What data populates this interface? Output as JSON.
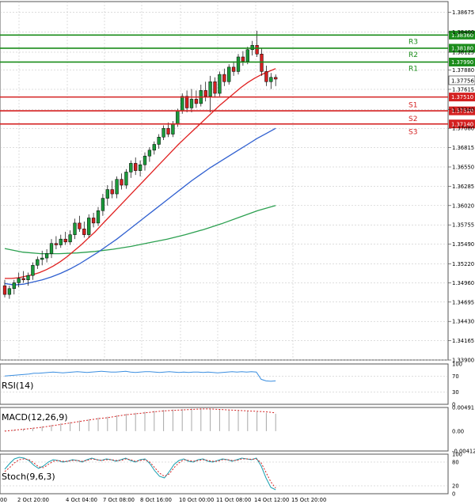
{
  "chart_data": [
    {
      "type": "candlestick",
      "price_ylim": [
        1.339,
        1.3882
      ],
      "price_ticks": [
        "1.38675",
        "1.38400",
        "1.38125",
        "1.37880",
        "1.37615",
        "1.37340",
        "1.37080",
        "1.36815",
        "1.36550",
        "1.36285",
        "1.36020",
        "1.35755",
        "1.35490",
        "1.35220",
        "1.34960",
        "1.34695",
        "1.34430",
        "1.34165",
        "1.33900"
      ],
      "x_labels": [
        "2 Oct 20:00",
        "4 Oct 04:00",
        "7 Oct 08:00",
        "8 Oct 16:00",
        "10 Oct 00:00",
        "11 Oct 08:00",
        "14 Oct 12:00",
        "15 Oct 20:00"
      ],
      "x_first_label": "00",
      "current_price": "1.37756",
      "levels": [
        {
          "name": "R3",
          "value": 1.3836,
          "price_label": "1.38360",
          "color": "#1a8c1a"
        },
        {
          "name": "R2",
          "value": 1.3818,
          "price_label": "1.38180",
          "color": "#1a8c1a"
        },
        {
          "name": "R1",
          "value": 1.3799,
          "price_label": "1.37990",
          "color": "#1a8c1a"
        },
        {
          "name": "S1",
          "value": 1.3751,
          "price_label": "1.37510",
          "color": "#d42020"
        },
        {
          "name": "S2",
          "value": 1.3732,
          "price_label": "1.37320",
          "color": "#d42020"
        },
        {
          "name": "S3",
          "value": 1.3714,
          "price_label": "1.37140",
          "color": "#d42020"
        }
      ],
      "candles": [
        {
          "o": 1.3492,
          "h": 1.35,
          "l": 1.3476,
          "c": 1.348
        },
        {
          "o": 1.348,
          "h": 1.3492,
          "l": 1.3474,
          "c": 1.3488
        },
        {
          "o": 1.3488,
          "h": 1.35,
          "l": 1.348,
          "c": 1.3496
        },
        {
          "o": 1.3496,
          "h": 1.351,
          "l": 1.349,
          "c": 1.3502
        },
        {
          "o": 1.3502,
          "h": 1.3512,
          "l": 1.3496,
          "c": 1.35
        },
        {
          "o": 1.35,
          "h": 1.351,
          "l": 1.3492,
          "c": 1.3506
        },
        {
          "o": 1.3506,
          "h": 1.3524,
          "l": 1.35,
          "c": 1.352
        },
        {
          "o": 1.352,
          "h": 1.3532,
          "l": 1.3515,
          "c": 1.3528
        },
        {
          "o": 1.3528,
          "h": 1.354,
          "l": 1.352,
          "c": 1.353
        },
        {
          "o": 1.353,
          "h": 1.3542,
          "l": 1.3524,
          "c": 1.3536
        },
        {
          "o": 1.3536,
          "h": 1.3556,
          "l": 1.353,
          "c": 1.355
        },
        {
          "o": 1.355,
          "h": 1.356,
          "l": 1.3542,
          "c": 1.3548
        },
        {
          "o": 1.3548,
          "h": 1.3562,
          "l": 1.3544,
          "c": 1.3556
        },
        {
          "o": 1.3556,
          "h": 1.3566,
          "l": 1.3548,
          "c": 1.3552
        },
        {
          "o": 1.3552,
          "h": 1.3568,
          "l": 1.3548,
          "c": 1.3562
        },
        {
          "o": 1.3562,
          "h": 1.3584,
          "l": 1.3556,
          "c": 1.3578
        },
        {
          "o": 1.3578,
          "h": 1.3588,
          "l": 1.3566,
          "c": 1.357
        },
        {
          "o": 1.357,
          "h": 1.358,
          "l": 1.3558,
          "c": 1.3562
        },
        {
          "o": 1.3562,
          "h": 1.359,
          "l": 1.3558,
          "c": 1.3585
        },
        {
          "o": 1.3585,
          "h": 1.3592,
          "l": 1.3572,
          "c": 1.3578
        },
        {
          "o": 1.3578,
          "h": 1.36,
          "l": 1.3574,
          "c": 1.3595
        },
        {
          "o": 1.3595,
          "h": 1.3618,
          "l": 1.3588,
          "c": 1.3612
        },
        {
          "o": 1.3612,
          "h": 1.363,
          "l": 1.3602,
          "c": 1.3624
        },
        {
          "o": 1.3624,
          "h": 1.3636,
          "l": 1.3612,
          "c": 1.3618
        },
        {
          "o": 1.3618,
          "h": 1.3642,
          "l": 1.3612,
          "c": 1.3638
        },
        {
          "o": 1.3638,
          "h": 1.3646,
          "l": 1.3624,
          "c": 1.363
        },
        {
          "o": 1.363,
          "h": 1.3652,
          "l": 1.3625,
          "c": 1.3648
        },
        {
          "o": 1.3648,
          "h": 1.3664,
          "l": 1.364,
          "c": 1.366
        },
        {
          "o": 1.366,
          "h": 1.3668,
          "l": 1.3644,
          "c": 1.365
        },
        {
          "o": 1.365,
          "h": 1.3664,
          "l": 1.3642,
          "c": 1.3658
        },
        {
          "o": 1.3658,
          "h": 1.3675,
          "l": 1.365,
          "c": 1.367
        },
        {
          "o": 1.367,
          "h": 1.3682,
          "l": 1.3662,
          "c": 1.3678
        },
        {
          "o": 1.3678,
          "h": 1.369,
          "l": 1.3672,
          "c": 1.3686
        },
        {
          "o": 1.3686,
          "h": 1.37,
          "l": 1.368,
          "c": 1.3696
        },
        {
          "o": 1.3696,
          "h": 1.3712,
          "l": 1.3692,
          "c": 1.3708
        },
        {
          "o": 1.3708,
          "h": 1.3716,
          "l": 1.3696,
          "c": 1.37
        },
        {
          "o": 1.37,
          "h": 1.3718,
          "l": 1.3696,
          "c": 1.3714
        },
        {
          "o": 1.3714,
          "h": 1.3735,
          "l": 1.371,
          "c": 1.3732
        },
        {
          "o": 1.3732,
          "h": 1.3756,
          "l": 1.3728,
          "c": 1.3752
        },
        {
          "o": 1.3752,
          "h": 1.376,
          "l": 1.373,
          "c": 1.3736
        },
        {
          "o": 1.3736,
          "h": 1.3762,
          "l": 1.373,
          "c": 1.3748
        },
        {
          "o": 1.3748,
          "h": 1.376,
          "l": 1.3736,
          "c": 1.3742
        },
        {
          "o": 1.3742,
          "h": 1.3768,
          "l": 1.3738,
          "c": 1.376
        },
        {
          "o": 1.376,
          "h": 1.3772,
          "l": 1.3745,
          "c": 1.3752
        },
        {
          "o": 1.3752,
          "h": 1.378,
          "l": 1.373,
          "c": 1.3772
        },
        {
          "o": 1.3772,
          "h": 1.3778,
          "l": 1.375,
          "c": 1.3756
        },
        {
          "o": 1.3756,
          "h": 1.3786,
          "l": 1.3752,
          "c": 1.3782
        },
        {
          "o": 1.3782,
          "h": 1.379,
          "l": 1.3766,
          "c": 1.3772
        },
        {
          "o": 1.3772,
          "h": 1.3796,
          "l": 1.3768,
          "c": 1.3792
        },
        {
          "o": 1.3792,
          "h": 1.38,
          "l": 1.378,
          "c": 1.3786
        },
        {
          "o": 1.3786,
          "h": 1.381,
          "l": 1.3782,
          "c": 1.3806
        },
        {
          "o": 1.3806,
          "h": 1.3814,
          "l": 1.3794,
          "c": 1.38
        },
        {
          "o": 1.38,
          "h": 1.382,
          "l": 1.3796,
          "c": 1.3816
        },
        {
          "o": 1.3816,
          "h": 1.3828,
          "l": 1.3808,
          "c": 1.3822
        },
        {
          "o": 1.3822,
          "h": 1.3842,
          "l": 1.3806,
          "c": 1.381
        },
        {
          "o": 1.381,
          "h": 1.3818,
          "l": 1.378,
          "c": 1.3786
        },
        {
          "o": 1.3786,
          "h": 1.3794,
          "l": 1.3766,
          "c": 1.3772
        },
        {
          "o": 1.3772,
          "h": 1.3784,
          "l": 1.3762,
          "c": 1.3778
        },
        {
          "o": 1.3778,
          "h": 1.3782,
          "l": 1.3766,
          "c": 1.37756
        }
      ],
      "ma_fast": [
        1.3502,
        1.3502,
        1.3503,
        1.3505,
        1.3507,
        1.351,
        1.3514,
        1.3519,
        1.3525,
        1.3532,
        1.354,
        1.3548,
        1.3557,
        1.3566,
        1.3576,
        1.3586,
        1.3596,
        1.3606,
        1.3616,
        1.3626,
        1.3636,
        1.3646,
        1.3656,
        1.3666,
        1.3676,
        1.3686,
        1.3695,
        1.3704,
        1.3713,
        1.3722,
        1.3731,
        1.374,
        1.3748,
        1.3756,
        1.3764,
        1.3771,
        1.3777,
        1.3782,
        1.3786,
        1.379
      ],
      "ma_fast_color": "#e02020",
      "ma_mid": [
        1.3495,
        1.3493,
        1.3494,
        1.3497,
        1.35,
        1.3504,
        1.3509,
        1.3515,
        1.3522,
        1.353,
        1.3538,
        1.3547,
        1.3556,
        1.3566,
        1.3576,
        1.3586,
        1.3596,
        1.3606,
        1.3616,
        1.3626,
        1.3636,
        1.3645,
        1.3654,
        1.3662,
        1.367,
        1.3678,
        1.3686,
        1.3694,
        1.3701,
        1.3708
      ],
      "ma_mid_color": "#3060d0",
      "ma_slow": [
        1.3543,
        1.3538,
        1.3536,
        1.3536,
        1.3537,
        1.3539,
        1.3542,
        1.3546,
        1.3551,
        1.3556,
        1.3562,
        1.3569,
        1.3577,
        1.3586,
        1.3595,
        1.3602
      ],
      "ma_slow_color": "#2ca050"
    },
    {
      "type": "line",
      "title": "RSI(14)",
      "ylim": [
        0,
        100
      ],
      "ticks": [
        "100",
        "70",
        "30",
        "0"
      ],
      "values": [
        70,
        71,
        72,
        73,
        74,
        75,
        77,
        77,
        78,
        79,
        80,
        79,
        78,
        79,
        80,
        81,
        80,
        79,
        80,
        81,
        82,
        81,
        80,
        80,
        81,
        82,
        80,
        79,
        80,
        81,
        81,
        80,
        79,
        80,
        81,
        80,
        79,
        80,
        79,
        80,
        80,
        79,
        80,
        79,
        78,
        79,
        80,
        81,
        80,
        81,
        80,
        81,
        80,
        62,
        58,
        57,
        58
      ]
    },
    {
      "type": "bar",
      "title": "MACD(12,26,9)",
      "ylim": [
        -0.00412,
        0.00491
      ],
      "ticks": [
        "0.00491",
        "0.00",
        "-0.00412"
      ],
      "values": [
        0.0001,
        0.0003,
        0.0005,
        0.0007,
        0.001,
        0.0013,
        0.0016,
        0.0019,
        0.0022,
        0.0025,
        0.0028,
        0.003,
        0.0033,
        0.0036,
        0.0038,
        0.004,
        0.0042,
        0.0044,
        0.0045,
        0.0046,
        0.0047,
        0.0047,
        0.0046,
        0.0045,
        0.0044,
        0.0043,
        0.0042,
        0.004,
        0.0038,
        0.0036
      ],
      "signal": [
        0.0,
        0.0002,
        0.0004,
        0.0006,
        0.0008,
        0.0011,
        0.0014,
        0.0017,
        0.002,
        0.0023,
        0.0026,
        0.0028,
        0.0031,
        0.0034,
        0.0036,
        0.0038,
        0.004,
        0.0042,
        0.0043,
        0.0044,
        0.0045,
        0.0046,
        0.0046,
        0.0045,
        0.0044,
        0.0043,
        0.0042,
        0.0041,
        0.004,
        0.0038
      ],
      "signal_color": "#d42020"
    },
    {
      "type": "line",
      "title": "Stoch(9,6,3)",
      "ylim": [
        0,
        100
      ],
      "ticks": [
        "100",
        "80",
        "20",
        "0"
      ],
      "main": [
        62,
        76,
        88,
        92,
        90,
        84,
        72,
        64,
        70,
        80,
        86,
        84,
        80,
        82,
        86,
        84,
        80,
        86,
        90,
        86,
        84,
        88,
        86,
        82,
        86,
        90,
        84,
        80,
        86,
        88,
        76,
        58,
        44,
        40,
        56,
        74,
        84,
        88,
        82,
        80,
        86,
        88,
        82,
        80,
        84,
        88,
        86,
        82,
        86,
        90,
        88,
        86,
        90,
        70,
        40,
        16,
        10
      ],
      "signal": [
        56,
        66,
        78,
        86,
        88,
        86,
        78,
        68,
        66,
        74,
        82,
        84,
        82,
        82,
        84,
        84,
        82,
        84,
        88,
        86,
        84,
        86,
        86,
        84,
        84,
        88,
        86,
        82,
        84,
        86,
        80,
        66,
        52,
        44,
        50,
        66,
        78,
        86,
        84,
        82,
        84,
        86,
        84,
        82,
        82,
        86,
        86,
        84,
        84,
        88,
        88,
        87,
        88,
        78,
        54,
        30,
        14
      ],
      "signal_color": "#d42020"
    }
  ]
}
